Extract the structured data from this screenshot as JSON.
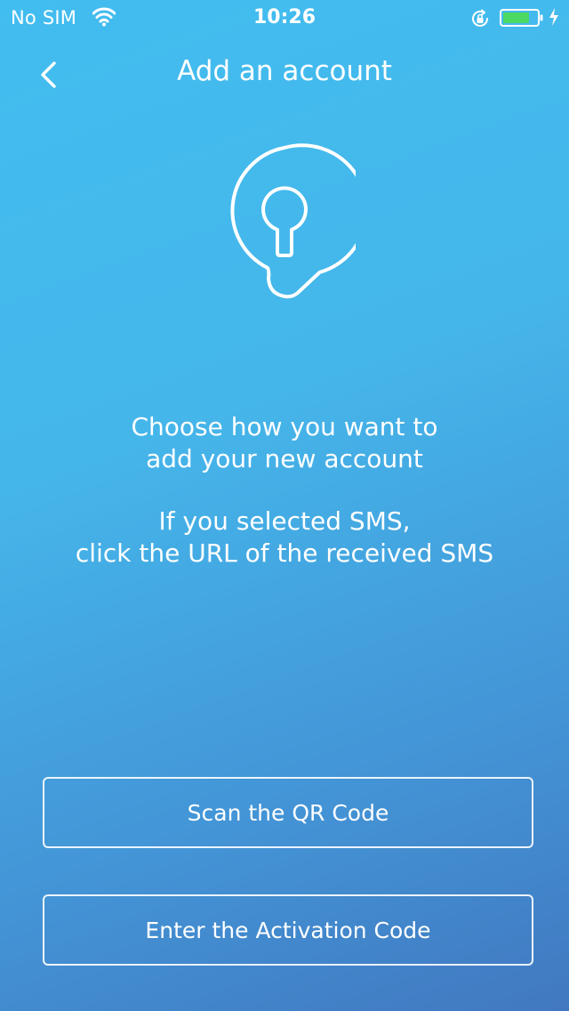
{
  "status_bar": {
    "carrier": "No SIM",
    "time": "10:26",
    "battery_color": "#4cd964"
  },
  "nav": {
    "title": "Add an account"
  },
  "message": {
    "line1": "Choose how you want to",
    "line2": "add your new account",
    "line3": "If you selected SMS,",
    "line4": "click the URL of the received SMS"
  },
  "actions": {
    "scan_label": "Scan the QR Code",
    "activation_label": "Enter the Activation Code"
  },
  "icons": {
    "hero": "keyhole-icon",
    "back": "chevron-left-icon"
  }
}
